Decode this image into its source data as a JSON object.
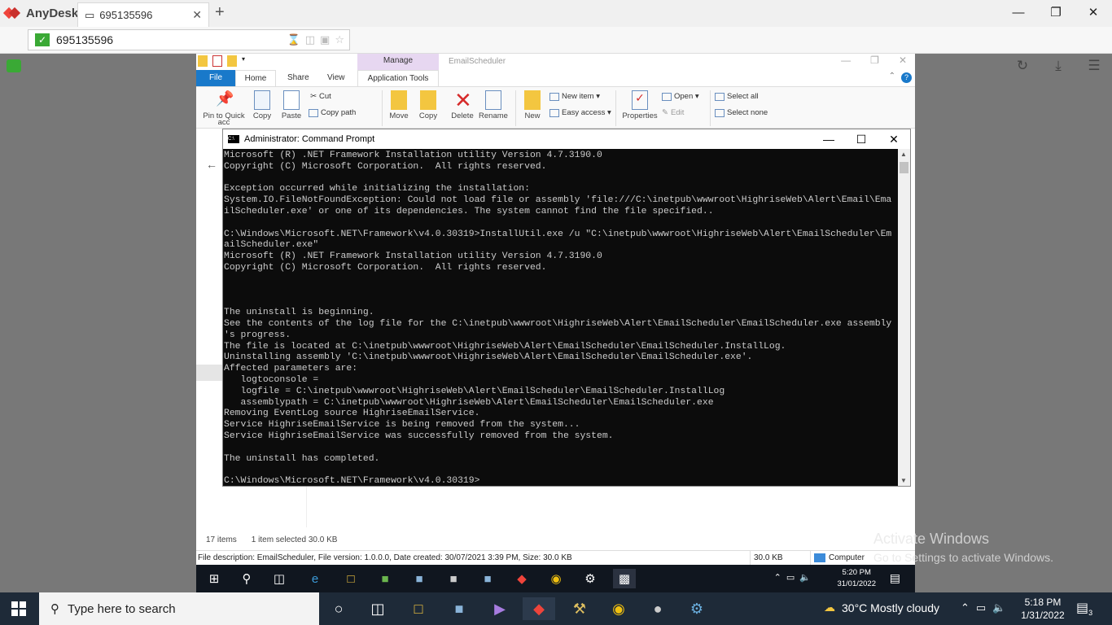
{
  "anydesk": {
    "app_name": "AnyDesk",
    "tab_label": "695135596",
    "address_value": "695135596",
    "monitor_label": "1"
  },
  "explorer": {
    "manage_tab": "Manage",
    "window_title": "EmailScheduler",
    "menu": {
      "file": "File",
      "home": "Home",
      "share": "Share",
      "view": "View",
      "app_tools": "Application Tools"
    },
    "ribbon": {
      "pin": "Pin to Quick",
      "pin2": "acc",
      "copy": "Copy",
      "paste": "Paste",
      "cut": "Cut",
      "copy_path": "Copy path",
      "move": "Move",
      "copy_to": "Copy",
      "delete": "Delete",
      "rename": "Rename",
      "new": "New",
      "new_item": "New item ▾",
      "easy_access": "Easy access ▾",
      "properties": "Properties",
      "open": "Open ▾",
      "edit": "Edit",
      "select_all": "Select all",
      "select_none": "Select none"
    },
    "status": {
      "items": "17 items",
      "selected": "1 item selected  30.0 KB"
    },
    "desc": {
      "description": "File description: EmailScheduler, File version: 1.0.0.0, Date created: 30/07/2021 3:39 PM, Size: 30.0 KB",
      "size": "30.0 KB",
      "location": "Computer"
    }
  },
  "cmd": {
    "title": "Administrator: Command Prompt",
    "lines": [
      "Microsoft (R) .NET Framework Installation utility Version 4.7.3190.0",
      "Copyright (C) Microsoft Corporation.  All rights reserved.",
      "",
      "Exception occurred while initializing the installation:",
      "System.IO.FileNotFoundException: Could not load file or assembly 'file:///C:\\inetpub\\wwwroot\\HighriseWeb\\Alert\\Email\\Ema",
      "ilScheduler.exe' or one of its dependencies. The system cannot find the file specified..",
      "",
      "C:\\Windows\\Microsoft.NET\\Framework\\v4.0.30319>InstallUtil.exe /u \"C:\\inetpub\\wwwroot\\HighriseWeb\\Alert\\EmailScheduler\\Em",
      "ailScheduler.exe\"",
      "Microsoft (R) .NET Framework Installation utility Version 4.7.3190.0",
      "Copyright (C) Microsoft Corporation.  All rights reserved.",
      "",
      "",
      "",
      "The uninstall is beginning.",
      "See the contents of the log file for the C:\\inetpub\\wwwroot\\HighriseWeb\\Alert\\EmailScheduler\\EmailScheduler.exe assembly",
      "'s progress.",
      "The file is located at C:\\inetpub\\wwwroot\\HighriseWeb\\Alert\\EmailScheduler\\EmailScheduler.InstallLog.",
      "Uninstalling assembly 'C:\\inetpub\\wwwroot\\HighriseWeb\\Alert\\EmailScheduler\\EmailScheduler.exe'.",
      "Affected parameters are:",
      "   logtoconsole =",
      "   logfile = C:\\inetpub\\wwwroot\\HighriseWeb\\Alert\\EmailScheduler\\EmailScheduler.InstallLog",
      "   assemblypath = C:\\inetpub\\wwwroot\\HighriseWeb\\Alert\\EmailScheduler\\EmailScheduler.exe",
      "Removing EventLog source HighriseEmailService.",
      "Service HighriseEmailService is being removed from the system...",
      "Service HighriseEmailService was successfully removed from the system.",
      "",
      "The uninstall has completed.",
      "",
      "C:\\Windows\\Microsoft.NET\\Framework\\v4.0.30319>"
    ]
  },
  "remote_taskbar": {
    "time": "5:20 PM",
    "date": "31/01/2022"
  },
  "watermark": {
    "line1": "Activate Windows",
    "line2": "Go to Settings to activate Windows."
  },
  "taskbar": {
    "search_placeholder": "Type here to search",
    "weather": "30°C  Mostly cloudy",
    "time": "5:18 PM",
    "date": "1/31/2022",
    "notifications": "3"
  }
}
